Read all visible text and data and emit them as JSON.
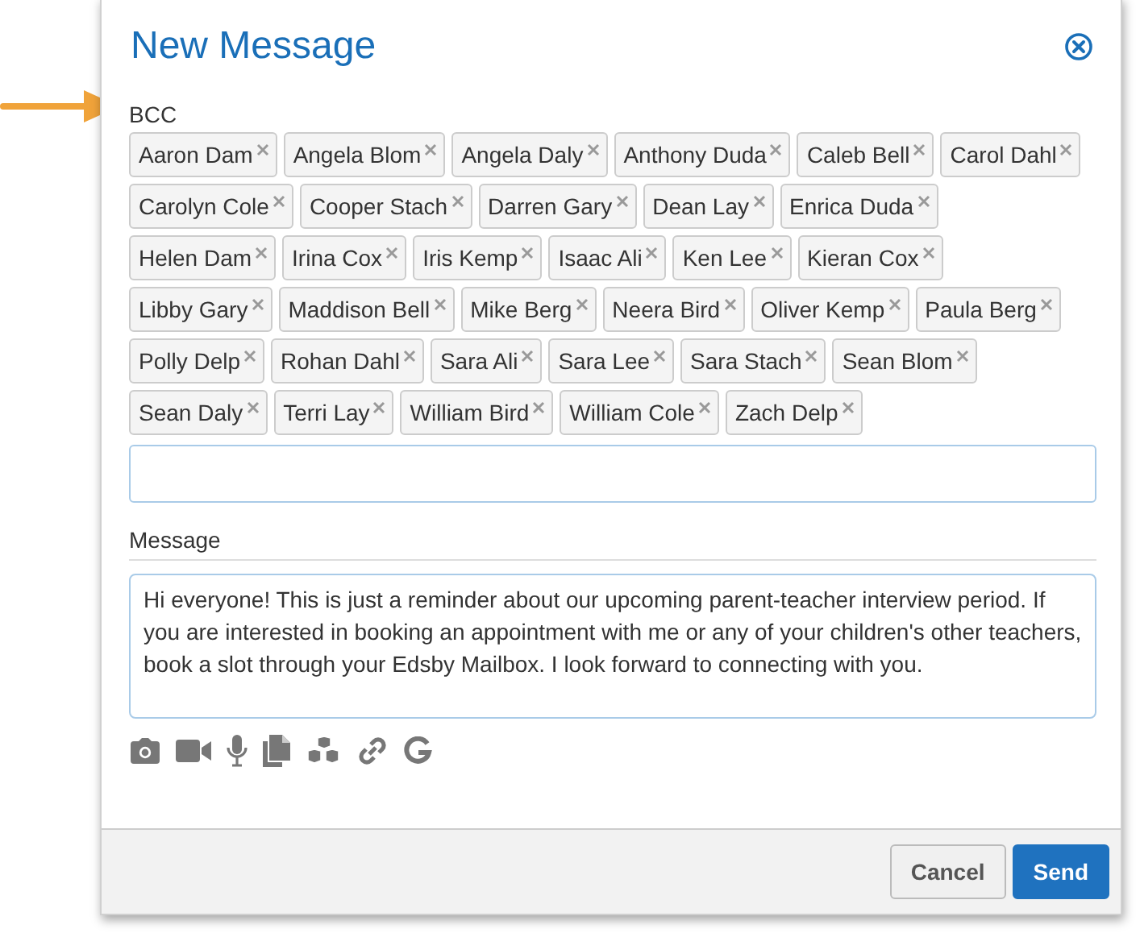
{
  "dialog": {
    "title": "New Message"
  },
  "bcc": {
    "label": "BCC",
    "recipients": [
      "Aaron Dam",
      "Angela Blom",
      "Angela Daly",
      "Anthony Duda",
      "Caleb Bell",
      "Carol Dahl",
      "Carolyn Cole",
      "Cooper Stach",
      "Darren Gary",
      "Dean Lay",
      "Enrica Duda",
      "Helen Dam",
      "Irina Cox",
      "Iris Kemp",
      "Isaac Ali",
      "Ken Lee",
      "Kieran Cox",
      "Libby Gary",
      "Maddison Bell",
      "Mike Berg",
      "Neera Bird",
      "Oliver Kemp",
      "Paula Berg",
      "Polly Delp",
      "Rohan Dahl",
      "Sara Ali",
      "Sara Lee",
      "Sara Stach",
      "Sean Blom",
      "Sean Daly",
      "Terri Lay",
      "William Bird",
      "William Cole",
      "Zach Delp"
    ]
  },
  "message": {
    "label": "Message",
    "value": "Hi everyone! This is just a reminder about our upcoming parent-teacher interview period. If you are interested in booking an appointment with me or any of your children's other teachers, book a slot through your Edsby Mailbox. I look forward to connecting with you."
  },
  "toolbar": [
    {
      "kind": "camera"
    },
    {
      "kind": "video"
    },
    {
      "kind": "mic"
    },
    {
      "kind": "files"
    },
    {
      "kind": "cubes"
    },
    {
      "kind": "link"
    },
    {
      "kind": "g"
    }
  ],
  "buttons": [
    {
      "label": "Cancel",
      "kind": "secondary"
    },
    {
      "label": "Send",
      "kind": "primary"
    }
  ]
}
